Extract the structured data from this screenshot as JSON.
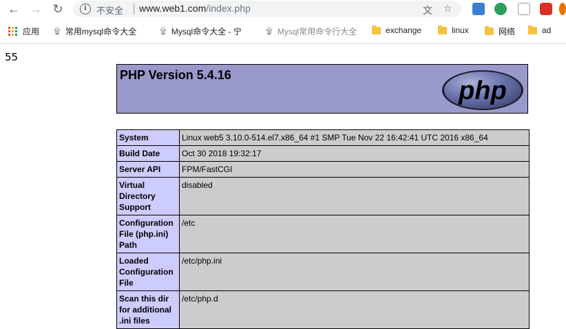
{
  "browser": {
    "security_label": "不安全",
    "url_host": "www.web1.com",
    "url_path": "/index.php"
  },
  "bookmarks": [
    {
      "label": "应用",
      "icon": "apps-grid-icon"
    },
    {
      "label": "常用mysql命令大全",
      "icon": "dolphin-icon"
    },
    {
      "label": "Mysql命令大全 - 宁",
      "icon": "dolphin-icon"
    },
    {
      "label": "Mysql常用命令行大全",
      "icon": "dolphin-icon"
    },
    {
      "label": "exchange",
      "icon": "folder-icon"
    },
    {
      "label": "linux",
      "icon": "folder-icon"
    },
    {
      "label": "网络",
      "icon": "folder-icon"
    },
    {
      "label": "ad",
      "icon": "folder-icon"
    }
  ],
  "page": {
    "output": "55",
    "php_title": "PHP Version 5.4.16",
    "logo_text": "php",
    "rows": [
      {
        "key": "System",
        "value": "Linux web5 3.10.0-514.el7.x86_64 #1 SMP Tue Nov 22 16:42:41 UTC 2016 x86_64"
      },
      {
        "key": "Build Date",
        "value": "Oct 30 2018 19:32:17"
      },
      {
        "key": "Server API",
        "value": "FPM/FastCGI"
      },
      {
        "key": "Virtual Directory Support",
        "value": "disabled"
      },
      {
        "key": "Configuration File (php.ini) Path",
        "value": "/etc"
      },
      {
        "key": "Loaded Configuration File",
        "value": "/etc/php.ini"
      },
      {
        "key": "Scan this dir for additional .ini files",
        "value": "/etc/php.d"
      }
    ]
  },
  "colors": {
    "header_bg": "#9999cc",
    "key_bg": "#ccccff",
    "value_bg": "#cccccc"
  }
}
